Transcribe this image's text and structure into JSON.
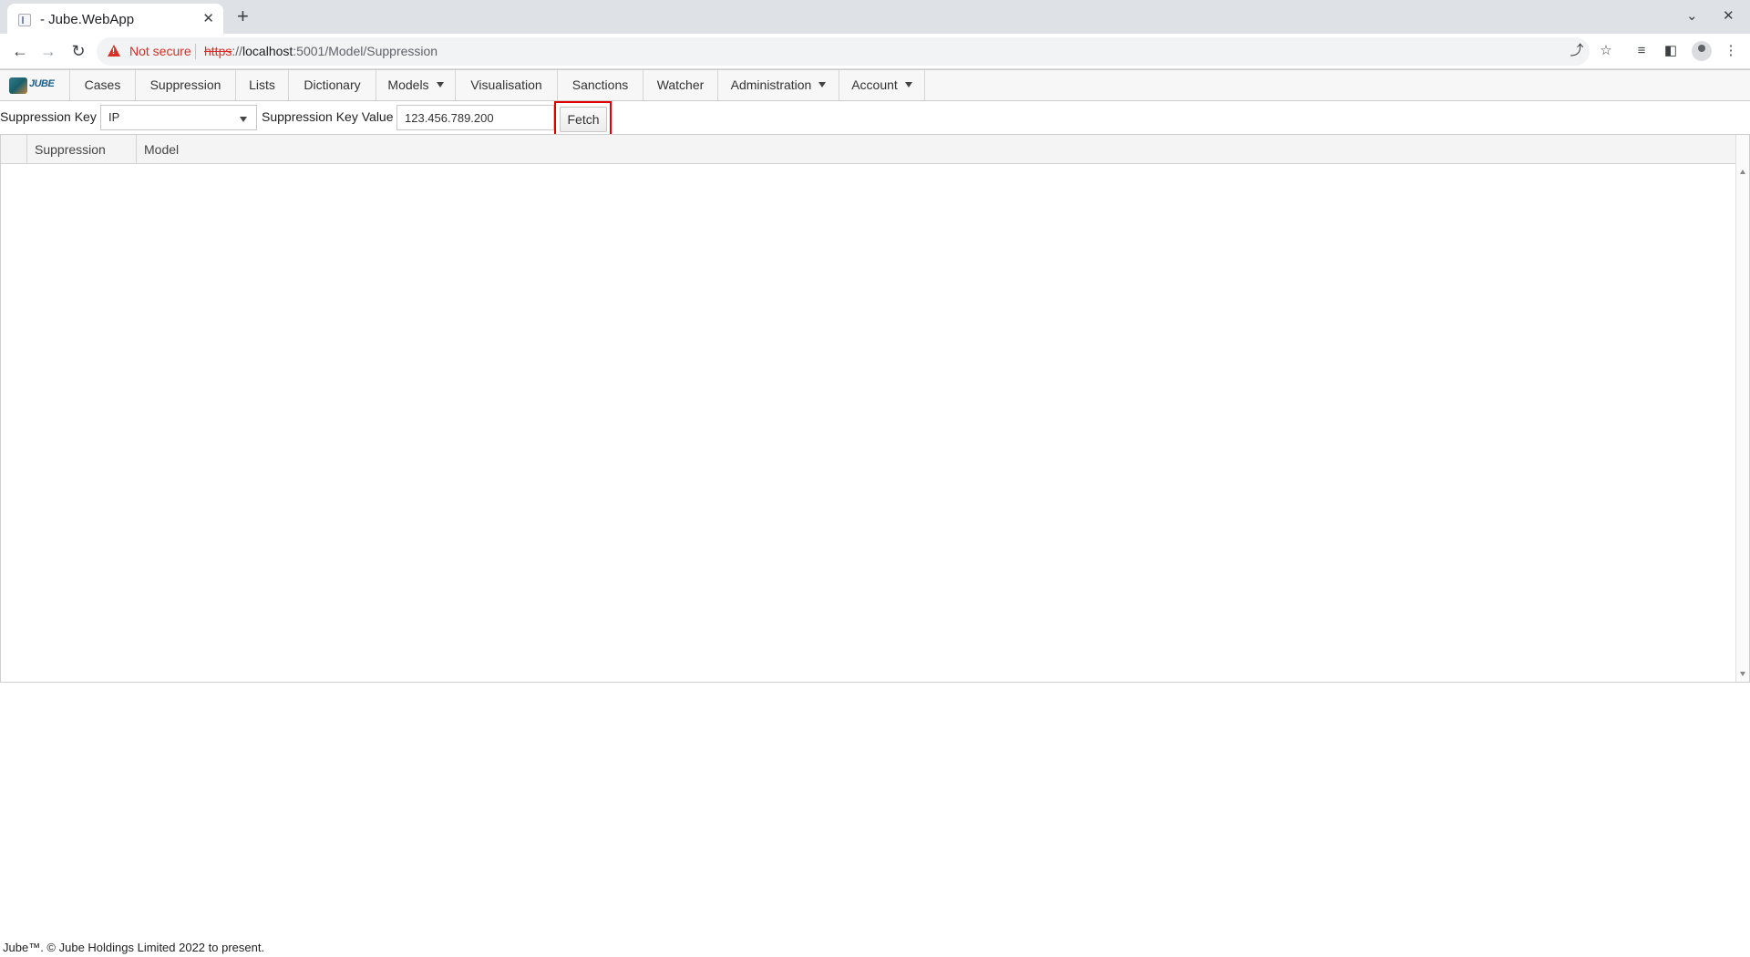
{
  "browser": {
    "tab_title": "- Jube.WebApp",
    "new_tab": "+",
    "tab_close": "✕",
    "security_label": "Not secure",
    "url_scheme": "https",
    "url_sep": "://",
    "url_host": "localhost",
    "url_rest": ":5001/Model/Suppression"
  },
  "app": {
    "logo_text": "JUBE",
    "menu": {
      "cases": "Cases",
      "suppression": "Suppression",
      "lists": "Lists",
      "dictionary": "Dictionary",
      "models": "Models",
      "visualisation": "Visualisation",
      "sanctions": "Sanctions",
      "watcher": "Watcher",
      "administration": "Administration",
      "account": "Account"
    }
  },
  "form": {
    "key_label": "Suppression Key",
    "key_value": "IP",
    "value_label": "Suppression Key Value",
    "value_input": "123.456.789.200",
    "fetch_label": "Fetch"
  },
  "grid": {
    "columns": [
      "",
      "Suppression",
      "Model"
    ],
    "rows": []
  },
  "footer": {
    "text": "Jube™. © Jube Holdings Limited 2022 to present."
  }
}
